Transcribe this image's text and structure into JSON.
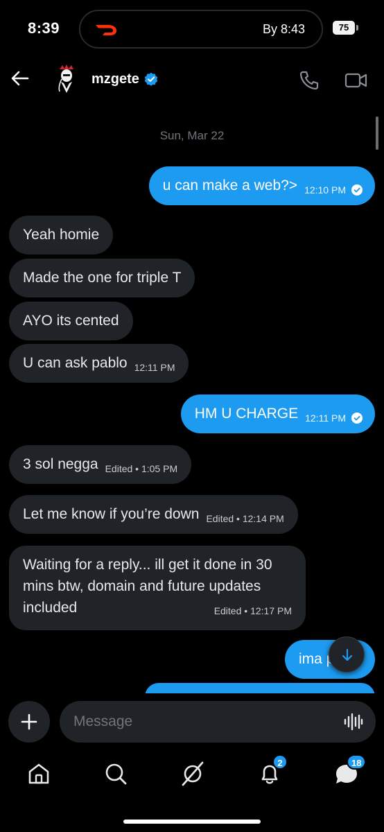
{
  "status_bar": {
    "time": "8:39",
    "live_activity_text": "By 8:43",
    "battery_level": "75"
  },
  "header": {
    "username": "mzgete",
    "verified": true,
    "accent_color": "#1d9bf0"
  },
  "conversation": {
    "date_separator": "Sun, Mar 22",
    "messages": [
      {
        "direction": "outgoing",
        "text": "u can make a web?>",
        "meta": "12:10 PM",
        "read": true
      },
      {
        "direction": "incoming",
        "text": "Yeah homie",
        "meta": ""
      },
      {
        "direction": "incoming",
        "text": "Made the one for triple T",
        "meta": ""
      },
      {
        "direction": "incoming",
        "text": "AYO its cented",
        "meta": ""
      },
      {
        "direction": "incoming",
        "text": "U can ask pablo",
        "meta": "12:11 PM"
      },
      {
        "direction": "outgoing",
        "text": "HM U CHARGE",
        "meta": "12:11 PM",
        "read": true
      },
      {
        "direction": "incoming",
        "text": "3 sol negga",
        "meta": "Edited • 1:05 PM"
      },
      {
        "direction": "incoming",
        "text": "Let me know if you’re down",
        "meta": "Edited • 12:14 PM"
      },
      {
        "direction": "incoming",
        "text": "Waiting for a reply... ill get it done in 30 mins btw, domain and future updates included",
        "meta": "Edited • 12:17 PM"
      },
      {
        "direction": "outgoing",
        "text": "ima p",
        "meta": ""
      }
    ]
  },
  "composer": {
    "placeholder": "Message"
  },
  "bottom_nav": {
    "items": [
      {
        "icon": "home-icon"
      },
      {
        "icon": "search-icon"
      },
      {
        "icon": "grok-icon"
      },
      {
        "icon": "notifications-icon",
        "badge": "2"
      },
      {
        "icon": "messages-icon",
        "badge": "18"
      }
    ]
  }
}
